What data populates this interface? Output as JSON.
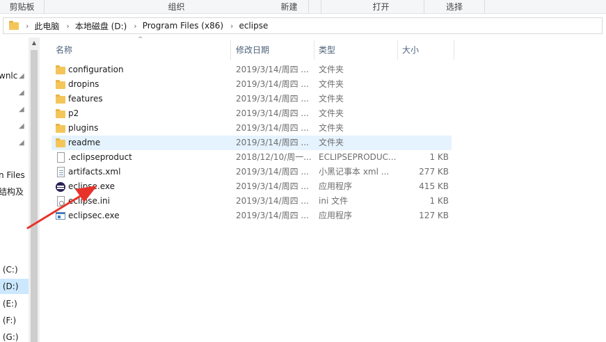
{
  "ribbon": {
    "groups": [
      "剪贴板",
      "组织",
      "新建",
      "打开",
      "选择"
    ]
  },
  "address": {
    "crumbs": [
      "此电脑",
      "本地磁盘 (D:)",
      "Program Files (x86)",
      "eclipse"
    ]
  },
  "nav": {
    "items": [
      "wnlc",
      "n Files",
      "结构及",
      ": (C:)",
      ": (D:)",
      ": (E:)",
      ": (F:)",
      ": (G:)"
    ],
    "selected": ": (D:)"
  },
  "columns": {
    "name": "名称",
    "date": "修改日期",
    "type": "类型",
    "size": "大小"
  },
  "files": [
    {
      "name": "configuration",
      "date": "2019/3/14/周四 ...",
      "type": "文件夹",
      "size": "",
      "icon": "folder-icon"
    },
    {
      "name": "dropins",
      "date": "2019/3/14/周四 ...",
      "type": "文件夹",
      "size": "",
      "icon": "folder-icon"
    },
    {
      "name": "features",
      "date": "2019/3/14/周四 ...",
      "type": "文件夹",
      "size": "",
      "icon": "folder-icon"
    },
    {
      "name": "p2",
      "date": "2019/3/14/周四 ...",
      "type": "文件夹",
      "size": "",
      "icon": "folder-icon"
    },
    {
      "name": "plugins",
      "date": "2019/3/14/周四 ...",
      "type": "文件夹",
      "size": "",
      "icon": "folder-icon"
    },
    {
      "name": "readme",
      "date": "2019/3/14/周四 ...",
      "type": "文件夹",
      "size": "",
      "icon": "folder-icon"
    },
    {
      "name": ".eclipseproduct",
      "date": "2018/12/10/周一...",
      "type": "ECLIPSEPRODUC...",
      "size": "1 KB",
      "icon": "file-icon"
    },
    {
      "name": "artifacts.xml",
      "date": "2019/3/14/周四 ...",
      "type": "小黑记事本 xml ...",
      "size": "277 KB",
      "icon": "xml-file-icon"
    },
    {
      "name": "eclipse.exe",
      "date": "2019/3/14/周四 ...",
      "type": "应用程序",
      "size": "415 KB",
      "icon": "eclipse-icon"
    },
    {
      "name": "eclipse.ini",
      "date": "2019/3/14/周四 ...",
      "type": "ini 文件",
      "size": "1 KB",
      "icon": "ini-file-icon"
    },
    {
      "name": "eclipsec.exe",
      "date": "2019/3/14/周四 ...",
      "type": "应用程序",
      "size": "127 KB",
      "icon": "application-icon"
    }
  ],
  "hover_row": "readme",
  "colors": {
    "hover": "#e5f3ff",
    "selected": "#cce8ff",
    "arrow": "#e8332a",
    "folder": "#f4c65a"
  }
}
